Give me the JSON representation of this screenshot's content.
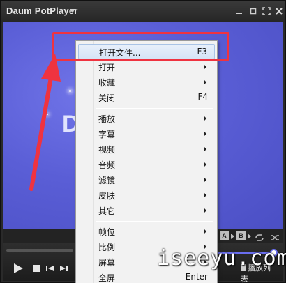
{
  "app": {
    "title": "Daum PotPlayer"
  },
  "video": {
    "visible_letter": "D"
  },
  "controls": {
    "ab_a": "A",
    "ab_b": "B",
    "playlist_label": "播放列表"
  },
  "menu": {
    "items": [
      {
        "label": "打开文件...",
        "shortcut": "F3",
        "submenu": false,
        "active": true
      },
      {
        "label": "打开",
        "shortcut": "",
        "submenu": true
      },
      {
        "label": "收藏",
        "shortcut": "",
        "submenu": true
      },
      {
        "label": "关闭",
        "shortcut": "F4",
        "submenu": false
      },
      {
        "label": "播放",
        "shortcut": "",
        "submenu": true
      },
      {
        "label": "字幕",
        "shortcut": "",
        "submenu": true
      },
      {
        "label": "视频",
        "shortcut": "",
        "submenu": true
      },
      {
        "label": "音频",
        "shortcut": "",
        "submenu": true
      },
      {
        "label": "滤镜",
        "shortcut": "",
        "submenu": true
      },
      {
        "label": "皮肤",
        "shortcut": "",
        "submenu": true
      },
      {
        "label": "其它",
        "shortcut": "",
        "submenu": true
      },
      {
        "label": "帧位",
        "shortcut": "",
        "submenu": true
      },
      {
        "label": "比例",
        "shortcut": "",
        "submenu": true
      },
      {
        "label": "屏幕",
        "shortcut": "",
        "submenu": true
      },
      {
        "label": "全屏",
        "shortcut": "Enter",
        "submenu": false
      }
    ]
  },
  "watermark": {
    "text": "iseeyu.com"
  },
  "colors": {
    "accent": "#6a6ef0",
    "highlight": "#ef3340",
    "video_bg": "#5a5ed6"
  }
}
